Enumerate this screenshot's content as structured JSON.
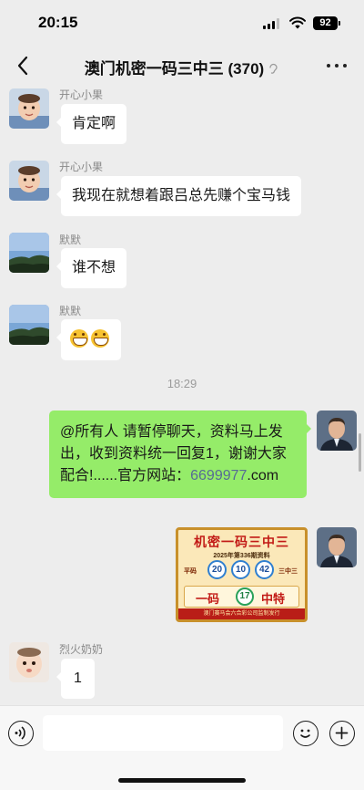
{
  "status": {
    "time": "20:15",
    "battery": "92",
    "signal_icon": "cellular-signal-icon",
    "wifi_icon": "wifi-icon"
  },
  "header": {
    "title": "澳门机密一码三中三 (370)",
    "back_icon": "chevron-left-icon",
    "mute_icon": "ear-mute-icon",
    "more_icon": "more-horizontal-icon"
  },
  "messages": [
    {
      "sender": "开心小果",
      "text": "肯定啊"
    },
    {
      "sender": "开心小果",
      "text": "我现在就想着跟吕总先赚个宝马钱"
    },
    {
      "sender": "默默",
      "text": "谁不想"
    },
    {
      "sender": "默默",
      "emoji": [
        "grinning-face-emoji",
        "grinning-face-emoji"
      ]
    },
    {
      "timestamp": "18:29"
    },
    {
      "sender": "me",
      "text_before": "@所有人 请暂停聊天，资料马上发出，收到资料统一回复1，谢谢大家配合!......官方网站：",
      "link": "6699977",
      "text_after": ".com"
    },
    {
      "sender": "me",
      "image": {
        "title": "机密一码三中三",
        "subtitle": "2025年第336期资料",
        "left_label": "平码",
        "right_label": "三中三",
        "numbers": [
          "20",
          "10",
          "42"
        ],
        "band_left": "一码",
        "special_number": "17",
        "band_right": "中特",
        "footer": "澳门赛马会六合彩公司监制发行"
      }
    },
    {
      "sender": "烈火奶奶",
      "text": "1"
    }
  ],
  "input_bar": {
    "voice_icon": "voice-input-icon",
    "emoji_icon": "emoji-face-icon",
    "plus_icon": "plus-circle-icon",
    "placeholder": ""
  },
  "colors": {
    "background": "#ededed",
    "bubble_self": "#95ec69",
    "bubble_other": "#ffffff",
    "link": "#576b95"
  }
}
